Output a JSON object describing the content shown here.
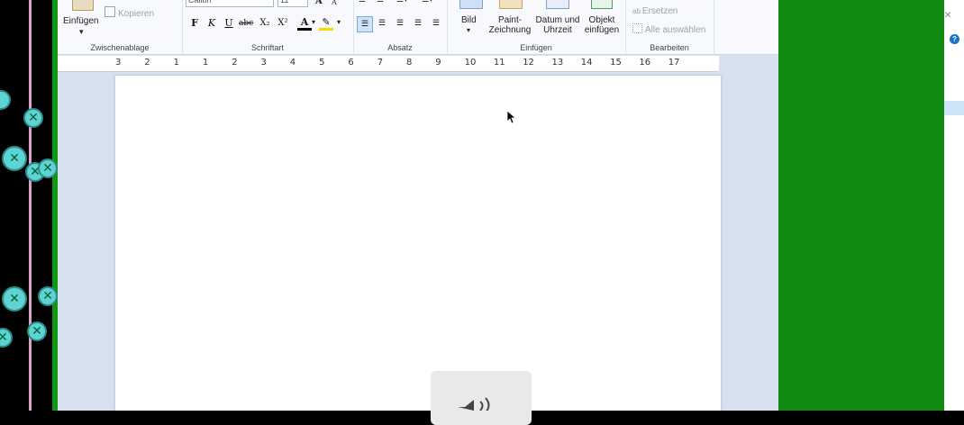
{
  "ribbon": {
    "clipboard": {
      "paste_label": "Einfügen",
      "copy_label": "Kopieren",
      "group_label": "Zwischenablage"
    },
    "font": {
      "font_name": "Calibri",
      "font_size": "11",
      "group_label": "Schriftart",
      "bold": "F",
      "italic": "K",
      "underline": "U",
      "strike": "abc",
      "subscript": "X₂",
      "superscript": "X²",
      "font_color": "A"
    },
    "paragraph": {
      "group_label": "Absatz"
    },
    "insert": {
      "picture": "Bild",
      "paint_line1": "Paint-",
      "paint_line2": "Zeichnung",
      "datetime_line1": "Datum und",
      "datetime_line2": "Uhrzeit",
      "object_line1": "Objekt",
      "object_line2": "einfügen",
      "group_label": "Einfügen"
    },
    "edit": {
      "replace": "Ersetzen",
      "select_all": "Alle auswählen",
      "group_label": "Bearbeiten"
    }
  },
  "ruler": {
    "numbers": [
      "3",
      "2",
      "1",
      "1",
      "2",
      "3",
      "4",
      "5",
      "6",
      "7",
      "8",
      "9",
      "10",
      "11",
      "12",
      "13",
      "14",
      "15",
      "16",
      "17"
    ]
  },
  "close_glyph": "✕",
  "colors": {
    "left_green": "#119811",
    "right_green": "#108a10",
    "bubble": "#5fd3d3"
  }
}
